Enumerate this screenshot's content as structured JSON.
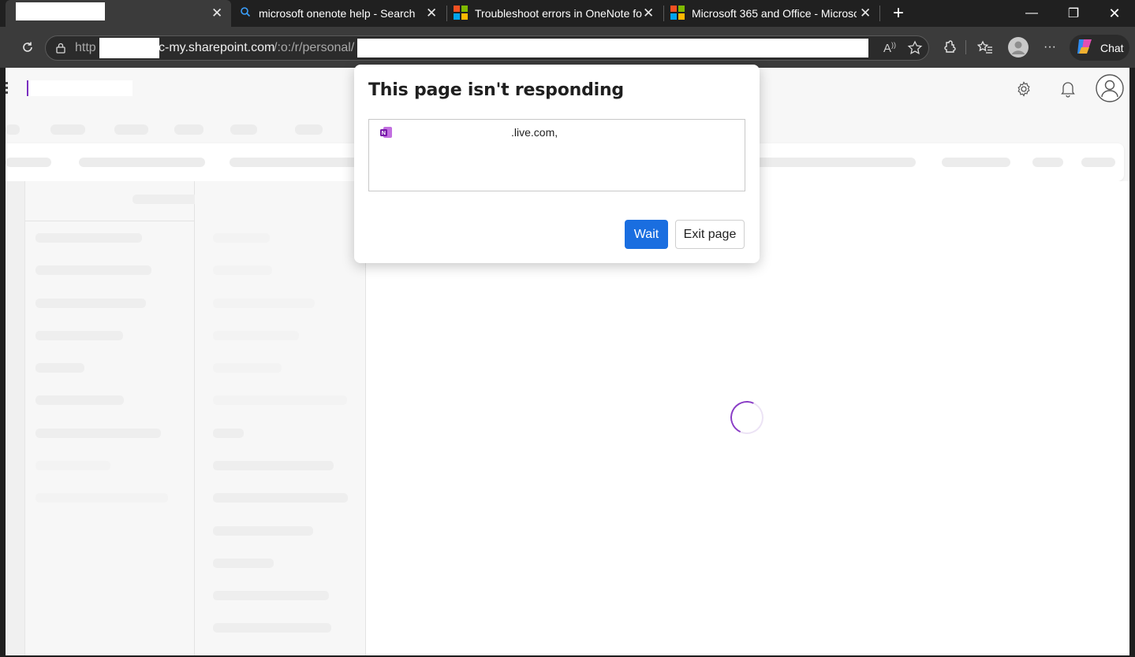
{
  "tabs": [
    {
      "title": "",
      "active": true
    },
    {
      "title": "microsoft onenote help - Search"
    },
    {
      "title": "Troubleshoot errors in OneNote fo"
    },
    {
      "title": "Microsoft 365 and Office - Microsc"
    }
  ],
  "tab_close_glyph": "✕",
  "new_tab_glyph": "+",
  "window": {
    "minimize": "—",
    "restore": "❐",
    "close": "✕"
  },
  "address": {
    "prefix": "http",
    "domain": "c-my.sharepoint.com",
    "path": "/:o:/r/personal/"
  },
  "toolbar": {
    "chat_label": "Chat",
    "more": "···"
  },
  "dialog": {
    "title": "This page isn't responding",
    "entry_text": ".live.com,",
    "wait_label": "Wait",
    "exit_label": "Exit page"
  },
  "colors": {
    "primary_button": "#1a6ee0",
    "spinner": "#8a3dc6",
    "onenote": "#7719aa"
  }
}
